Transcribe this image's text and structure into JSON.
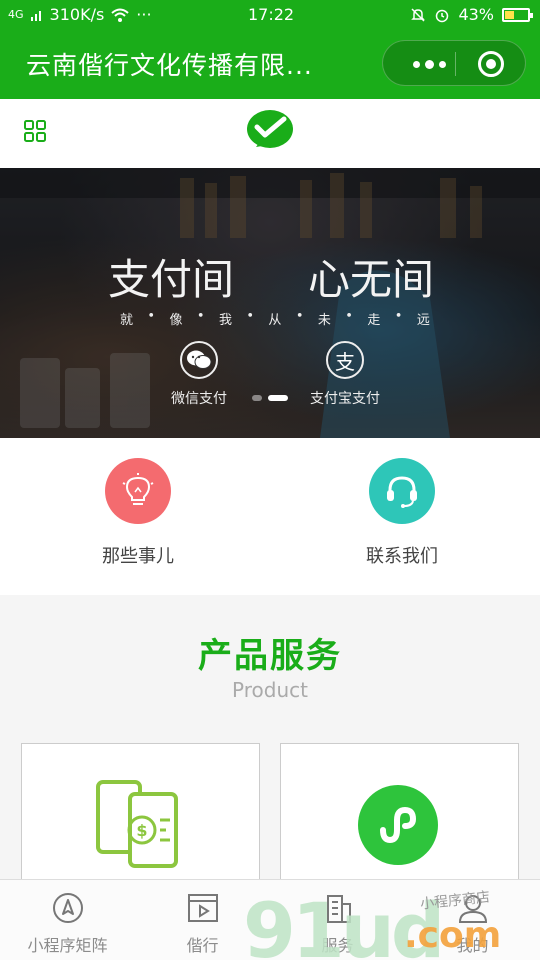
{
  "status_bar": {
    "network": "4G",
    "speed": "310K/s",
    "dots": "···",
    "time": "17:22",
    "battery_percent": "43%",
    "battery_level": 0.43
  },
  "nav": {
    "title": "云南偕行文化传播有限...",
    "capsule_more_icon": "more-dots-icon",
    "capsule_close_icon": "target-close-icon"
  },
  "header": {
    "menu_icon": "grid-icon",
    "logo_icon": "wechat-pay-check-icon"
  },
  "banner": {
    "slogan_left": "支付间",
    "slogan_right": "心无间",
    "slogan_line": [
      "就",
      "•",
      "像",
      "•",
      "我",
      "•",
      "从",
      "•",
      "未",
      "•",
      "走",
      "•",
      "远"
    ],
    "wechat_pay_label": "微信支付",
    "alipay_label": "支付宝支付",
    "alipay_glyph": "支",
    "slides": 2,
    "active_slide": 2
  },
  "quick_links": [
    {
      "label": "那些事儿",
      "icon": "lightbulb-icon",
      "color": "#f46b6f"
    },
    {
      "label": "联系我们",
      "icon": "headset-icon",
      "color": "#2ec6b8"
    }
  ],
  "product": {
    "title": "产品服务",
    "subtitle": "Product",
    "cards": [
      {
        "icon": "mobile-payment-icon",
        "color": "#8cc63f"
      },
      {
        "icon": "mini-program-icon",
        "color": "#2ec43c"
      }
    ]
  },
  "tabbar": [
    {
      "label": "小程序矩阵",
      "icon": "compass-icon"
    },
    {
      "label": "偕行",
      "icon": "video-play-icon"
    },
    {
      "label": "服务",
      "icon": "building-icon"
    },
    {
      "label": "我的",
      "icon": "user-icon"
    }
  ],
  "watermark": {
    "brand": "91ud",
    "domain": ".com",
    "tagline": "小程序商店"
  },
  "colors": {
    "brand_green": "#1aad19",
    "tab_gray": "#8c8c8c"
  }
}
